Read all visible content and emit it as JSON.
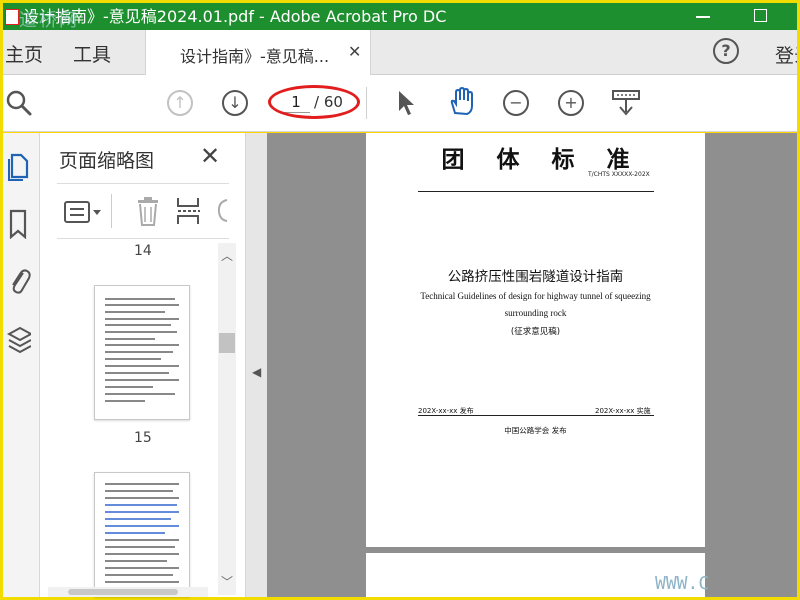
{
  "window": {
    "title": "设计指南》-意见稿2024.01.pdf - Adobe Acrobat Pro DC",
    "watermark_logo": "道桥网",
    "colors": {
      "titlebar": "#1e8f2e",
      "frame": "#ffd400",
      "highlight": "#e21d1d"
    }
  },
  "tabs": {
    "home": "主页",
    "tools": "工具",
    "document": "设计指南》-意见稿...",
    "close": "✕",
    "help": "?",
    "signin": "登录"
  },
  "toolbar": {
    "page_current": "1",
    "page_total": "/ 60",
    "icons": [
      "search-icon",
      "page-up-icon",
      "page-down-icon",
      "select-cursor-icon",
      "hand-tool-icon",
      "zoom-out-icon",
      "zoom-in-icon",
      "scroll-mode-icon"
    ]
  },
  "sidebar": {
    "icons": [
      "page-thumbnails-icon",
      "bookmark-icon",
      "attachment-icon",
      "layers-icon"
    ]
  },
  "thumbnails": {
    "title": "页面缩略图",
    "close": "✕",
    "pages": [
      {
        "number": "14"
      },
      {
        "number": "15"
      }
    ]
  },
  "document": {
    "heading": "团体标准",
    "code": "T/CHTS XXXXX-202X",
    "title_cn": "公路挤压性围岩隧道设计指南",
    "title_en_line1": "Technical Guidelines of design for highway tunnel of squeezing",
    "title_en_line2": "surrounding rock",
    "draft_note": "(征求意见稿)",
    "issue_date": "202X-xx-xx 发布",
    "effective_date": "202X-xx-xx 实施",
    "publisher": "中国公路学会  发布"
  },
  "watermark": "WWW.C"
}
